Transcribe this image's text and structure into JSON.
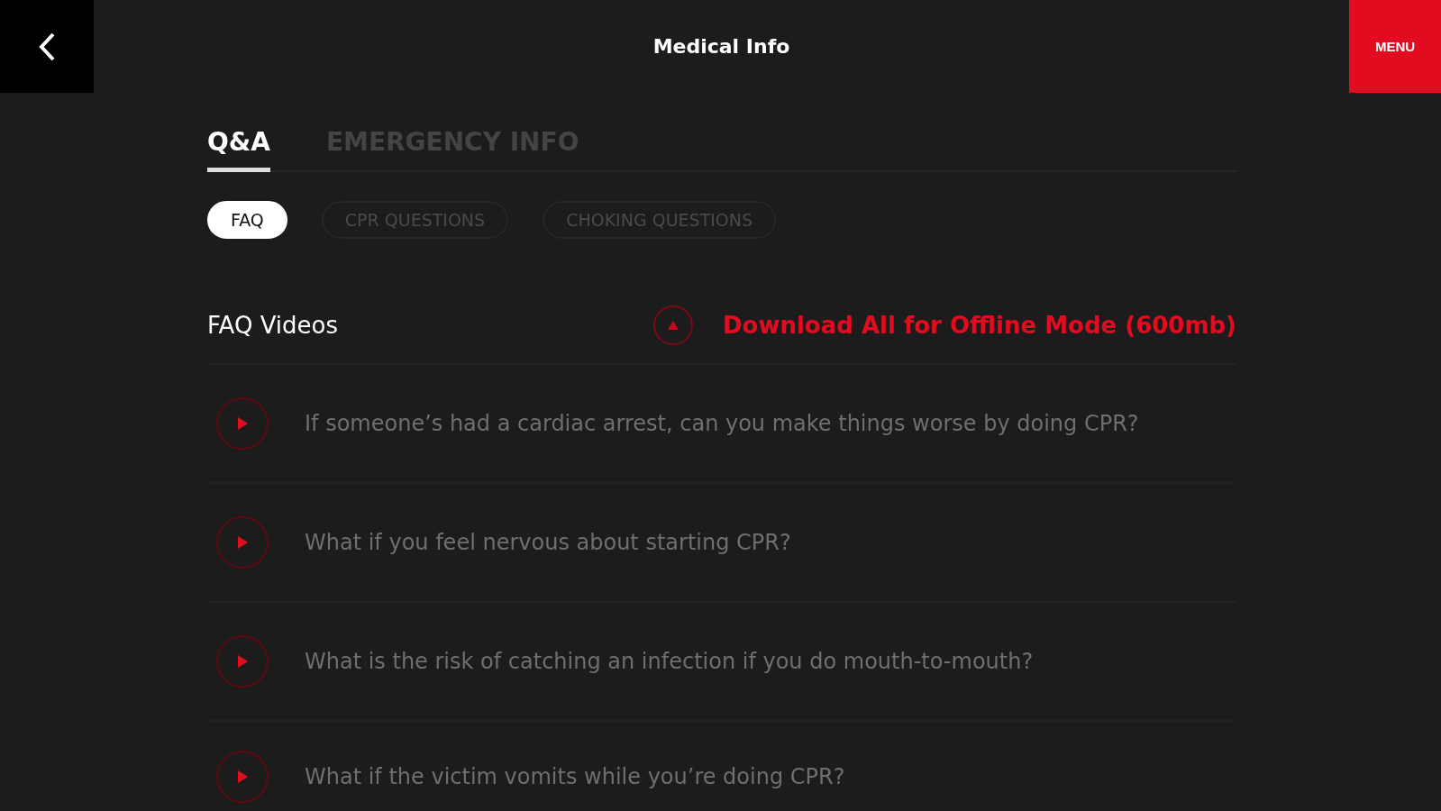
{
  "header": {
    "title": "Medical Info",
    "menu_label": "MENU"
  },
  "tabs": [
    {
      "label": "Q&A",
      "selected": true
    },
    {
      "label": "EMERGENCY INFO",
      "selected": false
    }
  ],
  "filters": [
    {
      "label": "FAQ",
      "selected": true
    },
    {
      "label": "CPR QUESTIONS",
      "selected": false
    },
    {
      "label": "CHOKING QUESTIONS",
      "selected": false
    }
  ],
  "section": {
    "title": "FAQ Videos",
    "download_label": "Download All for Offline Mode (600mb)"
  },
  "videos": [
    {
      "question": "If someone’s had a cardiac arrest, can you make things worse by doing CPR?"
    },
    {
      "question": "What if you feel nervous about starting CPR?"
    },
    {
      "question": "What is the risk of catching an infection if you do mouth-to-mouth?"
    },
    {
      "question": "What if the victim vomits while you’re doing CPR?"
    }
  ]
}
